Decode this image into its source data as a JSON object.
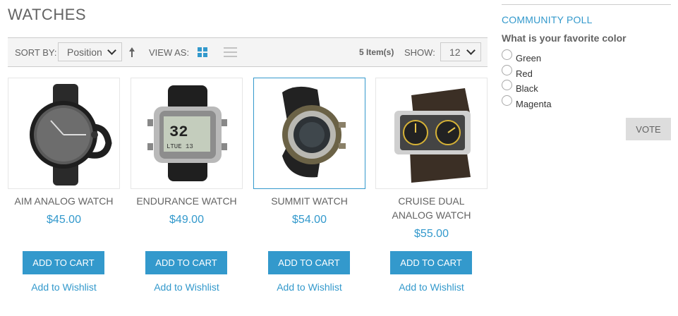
{
  "page": {
    "title": "WATCHES"
  },
  "toolbar": {
    "sort_label": "SORT BY:",
    "sort_value": "Position",
    "view_label": "VIEW AS:",
    "item_count": "5 Item(s)",
    "show_label": "SHOW:",
    "show_value": "12"
  },
  "products": [
    {
      "name": "AIM ANALOG WATCH",
      "price": "$45.00",
      "cart_label": "ADD TO CART",
      "wishlist_label": "Add to Wishlist"
    },
    {
      "name": "ENDURANCE WATCH",
      "price": "$49.00",
      "cart_label": "ADD TO CART",
      "wishlist_label": "Add to Wishlist"
    },
    {
      "name": "SUMMIT WATCH",
      "price": "$54.00",
      "cart_label": "ADD TO CART",
      "wishlist_label": "Add to Wishlist"
    },
    {
      "name": "CRUISE DUAL ANALOG WATCH",
      "price": "$55.00",
      "cart_label": "ADD TO CART",
      "wishlist_label": "Add to Wishlist"
    }
  ],
  "poll": {
    "title": "COMMUNITY POLL",
    "question": "What is your favorite color",
    "options": [
      "Green",
      "Red",
      "Black",
      "Magenta"
    ],
    "vote_label": "VOTE"
  },
  "watch_faces": {
    "endurance": {
      "line1": "32",
      "line2": "LTUE 13"
    }
  },
  "colors": {
    "accent": "#3399cc",
    "text": "#636363",
    "toolbar_bg": "#f4f4f4",
    "vote_bg": "#dddddd"
  }
}
